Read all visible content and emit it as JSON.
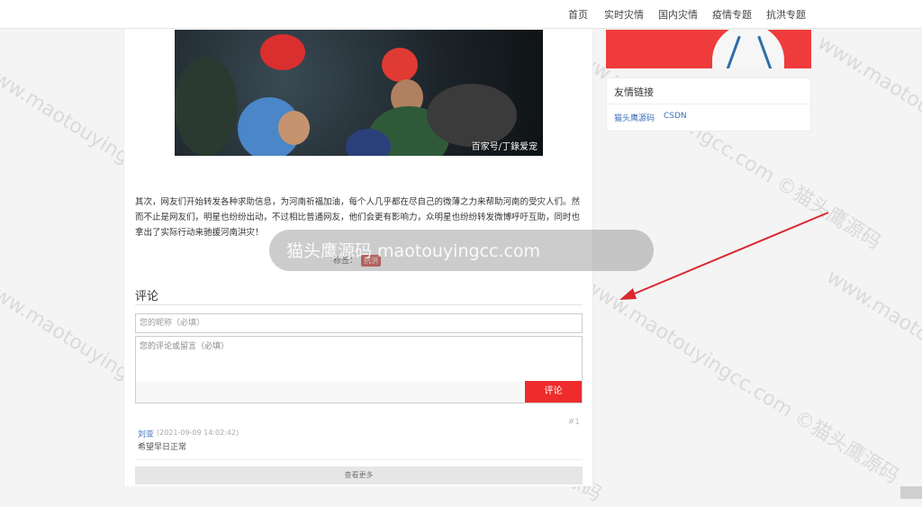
{
  "nav": {
    "items": [
      "首页",
      "实时灾情",
      "国内灾情",
      "疫情专题",
      "抗洪专题"
    ]
  },
  "article": {
    "photo_caption": "百家号/丁錄爱宠",
    "paragraph": "其次，网友们开始转发各种求助信息，为河南祈福加油，每个人几乎都在尽自己的微薄之力来帮助河南的受灾人们。然而不止是网友们，明星也纷纷出动，不过相比普通网友，他们会更有影响力，众明星也纷纷转发微博呼吁互助，同时也拿出了实际行动来驰援河南洪灾！",
    "tags_label": "标签：",
    "tag": "抗洪"
  },
  "comments": {
    "title": "评论",
    "name_placeholder": "您的昵称（必填）",
    "message_placeholder": "您的评论或留言（必填）",
    "submit_label": "评论",
    "floor": "#1",
    "author": "刘亚",
    "date": "(2021-09-09 14:02:42)",
    "text": "希望早日正常",
    "more_label": "查看更多"
  },
  "sidebar": {
    "links_title": "友情链接",
    "links": [
      "猫头鹰源码",
      "CSDN"
    ]
  },
  "overlay": {
    "text": "猫头鹰源码 maotouyingcc.com"
  },
  "watermark": {
    "text": "www.maotouyingcc.com ©猫头鹰源码"
  },
  "colors": {
    "accent": "#ef2c2c",
    "arrow": "#d9282f",
    "link": "#3b6fb6"
  }
}
